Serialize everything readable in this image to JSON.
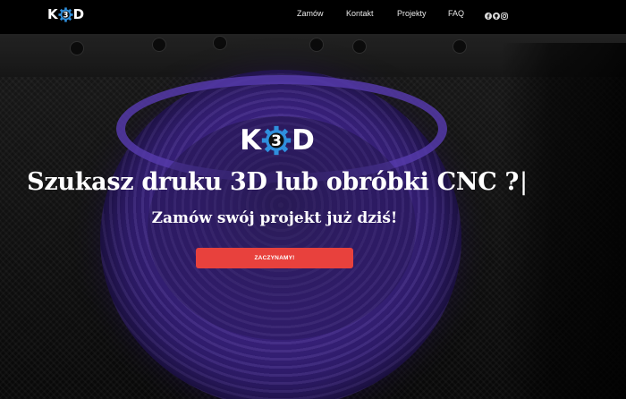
{
  "brand": {
    "logo_left": "K",
    "logo_gear_digit": "3",
    "logo_right": "D",
    "accent_color": "#2f8fdd"
  },
  "nav": {
    "items": [
      {
        "label": "Zamów"
      },
      {
        "label": "Kontakt"
      },
      {
        "label": "Projekty"
      },
      {
        "label": "FAQ"
      }
    ],
    "socials": [
      {
        "icon": "facebook-icon"
      },
      {
        "icon": "github-icon"
      },
      {
        "icon": "instagram-icon"
      }
    ]
  },
  "hero": {
    "heading": "Szukasz druku 3D lub obróbki CNC ?",
    "caret": "|",
    "subheading": "Zamów swój projekt już dziś!",
    "cta_label": "ZACZYNAMY!",
    "cta_color": "#e8413d"
  }
}
